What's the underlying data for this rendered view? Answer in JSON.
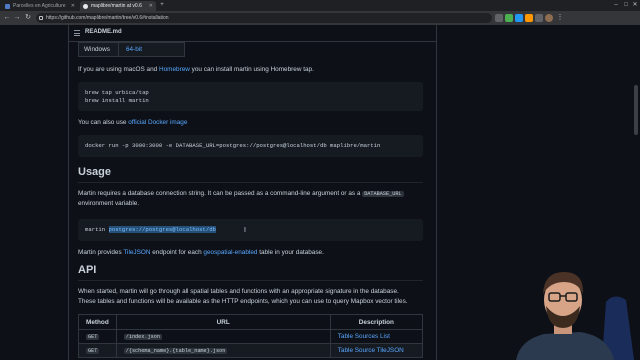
{
  "browser": {
    "tabs": [
      {
        "label": "Parcelles en Agriculture",
        "active": false,
        "favicon_color": "#4e7ac7"
      },
      {
        "label": "maplibre/martin at v0.6",
        "active": true,
        "favicon_color": "#e8eaed"
      }
    ],
    "url": "https://github.com/maplibre/martin/tree/v0.6#installation"
  },
  "readme": {
    "title": "README.md",
    "windows_row": {
      "os": "Windows",
      "arch": "64-bit"
    },
    "macos_text_1": "If you are using macOS and ",
    "macos_link": "Homebrew",
    "macos_text_2": " you can install martin using Homebrew tap.",
    "brew_code": "brew tap urbica/tap\nbrew install martin",
    "docker_text": "You can also use ",
    "docker_link": "official Docker image",
    "docker_code": "docker run -p 3000:3000 -e DATABASE_URL=postgres://postgres@localhost/db maplibre/martin",
    "usage_heading": "Usage",
    "usage_text_1": "Martin requires a database connection string. It can be passed as a command-line argument or as a ",
    "usage_inline_code": "DATABASE_URL",
    "usage_text_2": "environment variable.",
    "usage_code_prefix": "martin ",
    "usage_code_highlight": "postgres://postgres@localhost/db",
    "provides_text_1": "Martin provides ",
    "provides_link_1": "TileJSON",
    "provides_text_2": " endpoint for each ",
    "provides_link_2": "geospatial-enabled",
    "provides_text_3": " table in your database.",
    "api_heading": "API",
    "api_text_1": "When started, martin will go through all spatial tables and functions with an appropriate signature in the database.",
    "api_text_2": "These tables and functions will be available as the HTTP endpoints, which you can use to query Mapbox vector tiles.",
    "api_table": {
      "headers": [
        "Method",
        "URL",
        "Description"
      ],
      "rows": [
        {
          "method": "GET",
          "url": "/index.json",
          "description": "Table Sources List"
        },
        {
          "method": "GET",
          "url": "/{schema_name}.{table_name}.json",
          "description": "Table Source TileJSON"
        }
      ]
    }
  },
  "colors": {
    "page_bg": "#0d1117",
    "link": "#58a6ff",
    "code_bg": "#161b22",
    "border": "#30363d"
  }
}
